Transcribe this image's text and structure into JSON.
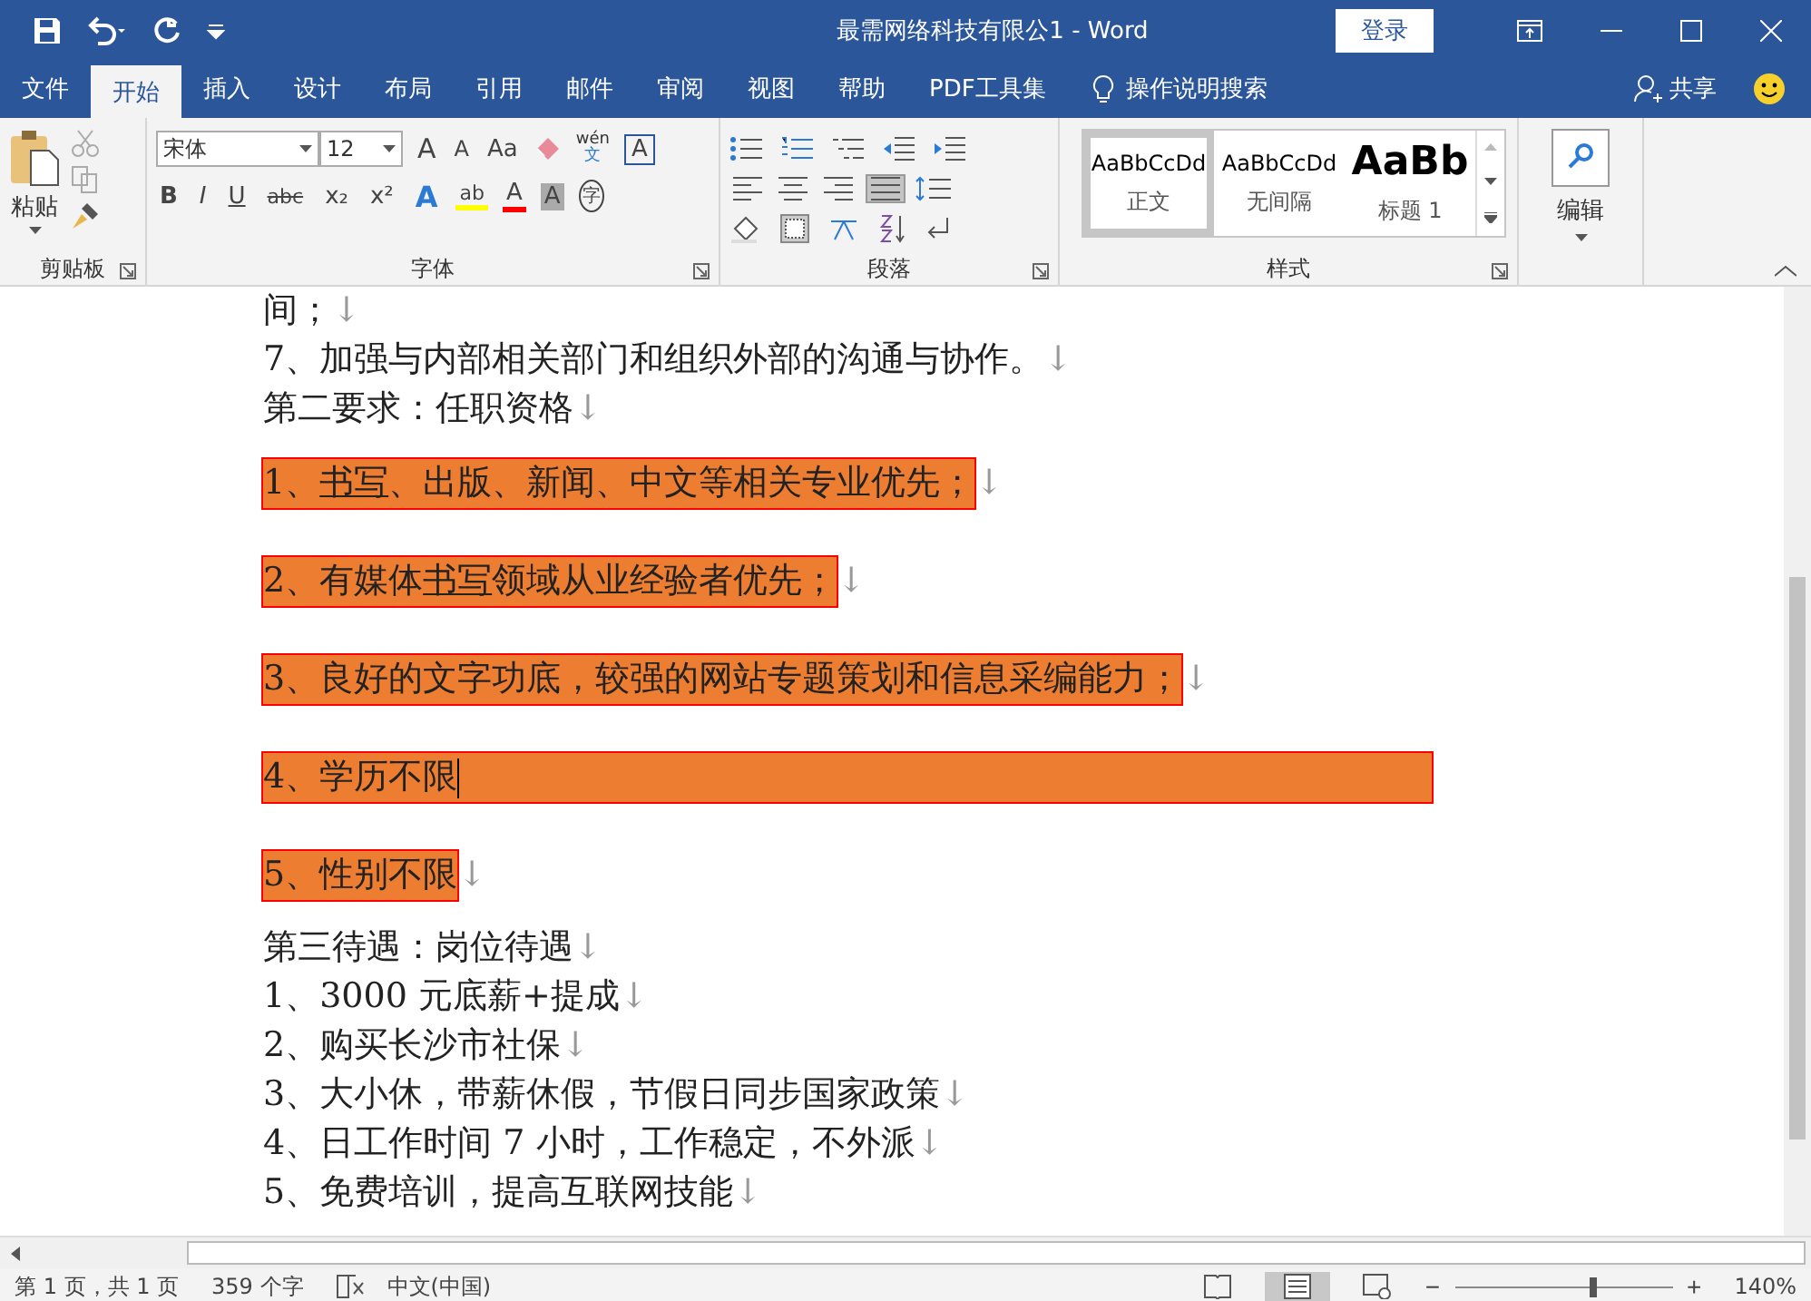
{
  "window": {
    "title": "最需网络科技有限公1 - Word",
    "login": "登录"
  },
  "tabs": [
    {
      "label": "文件",
      "selected": false
    },
    {
      "label": "开始",
      "selected": true
    },
    {
      "label": "插入",
      "selected": false
    },
    {
      "label": "设计",
      "selected": false
    },
    {
      "label": "布局",
      "selected": false
    },
    {
      "label": "引用",
      "selected": false
    },
    {
      "label": "邮件",
      "selected": false
    },
    {
      "label": "审阅",
      "selected": false
    },
    {
      "label": "视图",
      "selected": false
    },
    {
      "label": "帮助",
      "selected": false
    },
    {
      "label": "PDF工具集",
      "selected": false
    }
  ],
  "tell_me": "操作说明搜索",
  "share": "共享",
  "clipboard": {
    "paste": "粘贴",
    "group": "剪贴板"
  },
  "font": {
    "name": "宋体",
    "size": "12",
    "group": "字体",
    "grow": "A",
    "shrink": "A",
    "case": "Aa",
    "phonetic_top": "wén",
    "phonetic_bottom": "文",
    "border": "A",
    "format": [
      "B",
      "I",
      "U",
      "abc",
      "x₂",
      "x²"
    ],
    "effects": "A",
    "highlight": "ab",
    "color_label": "A",
    "shade": "A",
    "enclose": "字"
  },
  "paragraph": {
    "group": "段落",
    "align": [
      {
        "selected": false
      },
      {
        "selected": false
      },
      {
        "selected": false
      },
      {
        "selected": true
      }
    ]
  },
  "styles": {
    "group": "样式",
    "items": [
      {
        "preview": "AaBbCcDd",
        "name": "正文",
        "kind": "normal",
        "selected": true
      },
      {
        "preview": "AaBbCcDd",
        "name": "无间隔",
        "kind": "normal",
        "selected": false
      },
      {
        "preview": "AaBb",
        "name": "标题 1",
        "kind": "heading",
        "selected": false
      }
    ]
  },
  "editing": {
    "label": "编辑"
  },
  "document": {
    "paragraphs": [
      {
        "kind": "plain",
        "segments": [
          {
            "text": "间；"
          }
        ],
        "mark": "↓"
      },
      {
        "kind": "plain",
        "segments": [
          {
            "text": "7、加强与内部相关部门和组织外部的沟通与协作。"
          }
        ],
        "mark": "↓"
      },
      {
        "kind": "plain",
        "segments": [
          {
            "text": "第二要求：任职资格"
          }
        ],
        "mark": "↓"
      },
      {
        "kind": "shaded",
        "segments": [
          {
            "text": "1、"
          },
          {
            "text": "书写",
            "underline": true
          },
          {
            "text": "、出版、新闻、中文等相关专业优先；"
          }
        ],
        "mark": "↓"
      },
      {
        "kind": "shaded",
        "segments": [
          {
            "text": "2、有媒体"
          },
          {
            "text": "书写",
            "underline": true
          },
          {
            "text": "领域从业经验者优先；"
          }
        ],
        "mark": "↓"
      },
      {
        "kind": "shaded",
        "segments": [
          {
            "text": "3、良好的文字功底，较强的网站专题策划和信息采编能力；"
          }
        ],
        "mark": "↓"
      },
      {
        "kind": "shaded",
        "segments": [
          {
            "text": "4、学历不限"
          }
        ],
        "cursor": true,
        "full_width": true
      },
      {
        "kind": "shaded",
        "segments": [
          {
            "text": "5、性别不限"
          }
        ],
        "mark": "↓"
      },
      {
        "kind": "plain",
        "segments": [
          {
            "text": "第三待遇：岗位待遇"
          }
        ],
        "mark": "↓"
      },
      {
        "kind": "plain",
        "segments": [
          {
            "text": "1、3000 元底薪+提成"
          }
        ],
        "mark": "↓"
      },
      {
        "kind": "plain",
        "segments": [
          {
            "text": "2、购买长沙市社保"
          }
        ],
        "mark": "↓"
      },
      {
        "kind": "plain",
        "segments": [
          {
            "text": "3、大小休，带薪休假，节假日同步国家政策"
          }
        ],
        "mark": "↓"
      },
      {
        "kind": "plain",
        "segments": [
          {
            "text": "4、日工作时间 7 小时，工作稳定，不外派"
          }
        ],
        "mark": "↓"
      },
      {
        "kind": "plain",
        "segments": [
          {
            "text": "5、免费培训，提高互联网技能"
          }
        ],
        "mark": "↓"
      }
    ]
  },
  "status_bar": {
    "page": "第 1 页，共 1 页",
    "words": "359 个字",
    "language": "中文(中国)",
    "zoom_out": "−",
    "zoom_in": "+",
    "zoom": "140%",
    "zoom_slider": {
      "level": 0.64
    }
  }
}
